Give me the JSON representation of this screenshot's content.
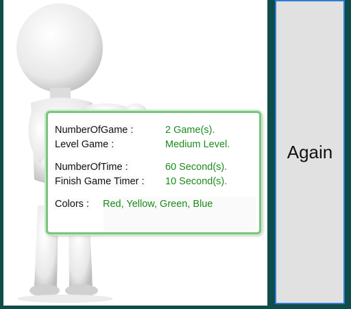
{
  "board": {
    "rows": [
      {
        "label": "NumberOfGame :",
        "value": "2 Game(s)."
      },
      {
        "label": "Level Game :",
        "value": "Medium Level."
      },
      {
        "label": "NumberOfTime :",
        "value": "60 Second(s)."
      },
      {
        "label": "Finish Game Timer :",
        "value": "10 Second(s)."
      },
      {
        "label": "Colors :",
        "value": "Red, Yellow, Green, Blue"
      }
    ]
  },
  "again_button": {
    "label": "Again"
  },
  "colors": {
    "background": "#0e4d4a",
    "accent": "#1a8a1a",
    "board_border": "#7bc47f",
    "button_border": "#2e7bd6"
  }
}
